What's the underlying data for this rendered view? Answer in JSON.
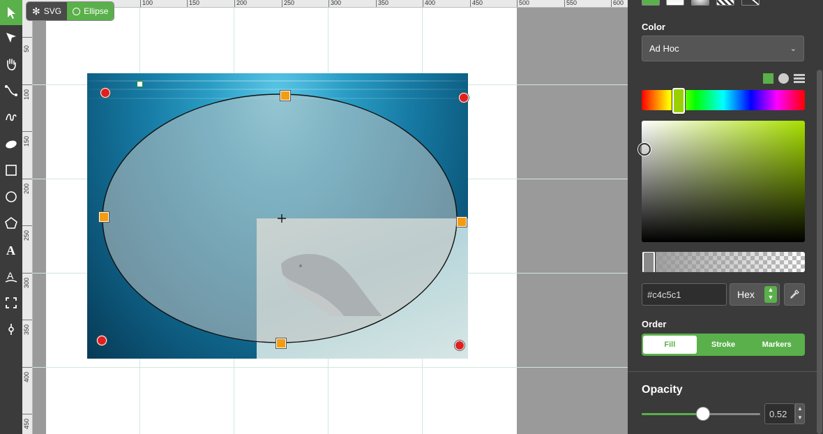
{
  "breadcrumb": {
    "root": "SVG",
    "current": "Ellipse"
  },
  "ruler": {
    "top_ticks": [
      "100",
      "150",
      "200",
      "250",
      "300",
      "350",
      "400",
      "450",
      "500",
      "550",
      "600"
    ],
    "left_ticks": [
      "50",
      "100",
      "150",
      "200",
      "250",
      "300",
      "350",
      "400",
      "450"
    ]
  },
  "tools": [
    {
      "name": "select-tool",
      "icon": "arrow-icon",
      "active": true
    },
    {
      "name": "node-select-tool",
      "icon": "subselect-icon"
    },
    {
      "name": "pan-tool",
      "icon": "hand-icon"
    },
    {
      "name": "line-tool",
      "icon": "line-icon"
    },
    {
      "name": "freehand-tool",
      "icon": "pen-icon"
    },
    {
      "name": "ellipse-path-tool",
      "icon": "ellipse-icon"
    },
    {
      "name": "rect-tool",
      "icon": "square-icon"
    },
    {
      "name": "circle-tool",
      "icon": "circle-icon"
    },
    {
      "name": "polygon-tool",
      "icon": "pentagon-icon"
    },
    {
      "name": "text-tool",
      "icon": "text-icon"
    },
    {
      "name": "text-path-tool",
      "icon": "text-path-icon"
    },
    {
      "name": "fit-tool",
      "icon": "expand-icon"
    },
    {
      "name": "eyedropper-tool",
      "icon": "pin-icon"
    }
  ],
  "panel": {
    "color_label": "Color",
    "color_mode": "Ad Hoc",
    "hex_value": "#c4c5c1",
    "hex_format": "Hex",
    "order_label": "Order",
    "order_options": [
      "Fill",
      "Stroke",
      "Markers"
    ],
    "order_active": "Fill",
    "opacity_label": "Opacity",
    "opacity_value": "0.52",
    "opacity_fraction": 0.52,
    "accent_color": "#5ab04a"
  }
}
